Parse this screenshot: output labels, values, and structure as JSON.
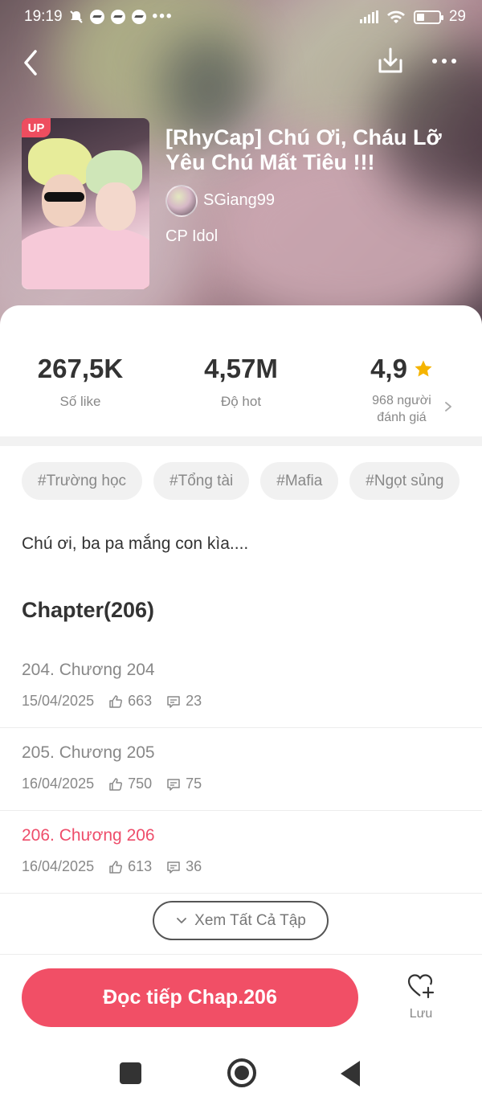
{
  "status_bar": {
    "time": "19:19",
    "battery": "29"
  },
  "hero": {
    "badge": "UP",
    "title": "[RhyCap] Chú Ơi, Cháu Lỡ Yêu Chú Mất Tiêu !!!",
    "author": "SGiang99",
    "category": "CP Idol"
  },
  "stats": {
    "likes_value": "267,5K",
    "likes_label": "Số like",
    "hot_value": "4,57M",
    "hot_label": "Độ hot",
    "rating_value": "4,9",
    "rating_label_line1": "968 người",
    "rating_label_line2": "đánh giá"
  },
  "tags": [
    "#Trường học",
    "#Tổng tài",
    "#Mafia",
    "#Ngọt sủng"
  ],
  "synopsis": "Chú ơi, ba pa mắng con kìa....",
  "chapters": {
    "heading": "Chapter(206)",
    "items": [
      {
        "name": "204. Chương 204",
        "date": "15/04/2025",
        "likes": "663",
        "comments": "23"
      },
      {
        "name": "205. Chương 205",
        "date": "16/04/2025",
        "likes": "750",
        "comments": "75"
      },
      {
        "name": "206. Chương 206",
        "date": "16/04/2025",
        "likes": "613",
        "comments": "36"
      }
    ],
    "see_all": "Xem Tất Cả Tập"
  },
  "actions": {
    "read_label": "Đọc tiếp Chap.206",
    "save_label": "Lưu"
  },
  "colors": {
    "accent": "#f14f66",
    "current_chapter": "#ee4d6a",
    "star": "#f5b400"
  }
}
